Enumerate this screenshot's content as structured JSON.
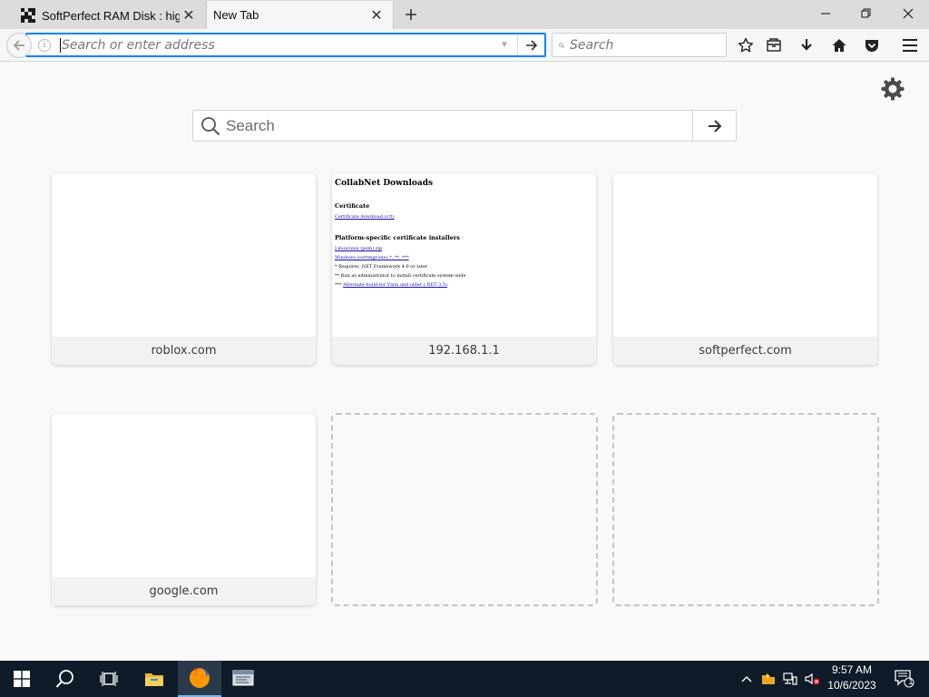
{
  "tabs": [
    {
      "title": "SoftPerfect RAM Disk : hig...",
      "active": false
    },
    {
      "title": "New Tab",
      "active": true
    }
  ],
  "navbar": {
    "url_placeholder": "Search or enter address",
    "url_value": "",
    "search_placeholder": "Search"
  },
  "newtab": {
    "search_placeholder": "Search",
    "tiles": [
      {
        "label": "roblox.com"
      },
      {
        "label": "192.168.1.1"
      },
      {
        "label": "softperfect.com"
      },
      {
        "label": "google.com"
      }
    ],
    "thumbnail_192": {
      "title": "CollabNet Downloads",
      "section1": "Certificate",
      "link1": "Certificate download (crt)",
      "section2": "Platform-specific certificate installers",
      "link2": "Linux/unix (pem).zip",
      "link3": "Windows (certmgr.exe) *, **, ***",
      "note1": "* Requires .NET Framework 4.0 or later",
      "note2": "** Run as administrator to install certificate system-wide",
      "note3_prefix": "***",
      "note3_link": "Alternate build for Vista and older (.NET 3.5)"
    }
  },
  "taskbar": {
    "time": "9:57 AM",
    "date": "10/6/2023",
    "notification_count": "1"
  },
  "colors": {
    "accent": "#0a84ff",
    "taskbar": "#0f1b28",
    "tabbar": "#dcdcdc"
  }
}
